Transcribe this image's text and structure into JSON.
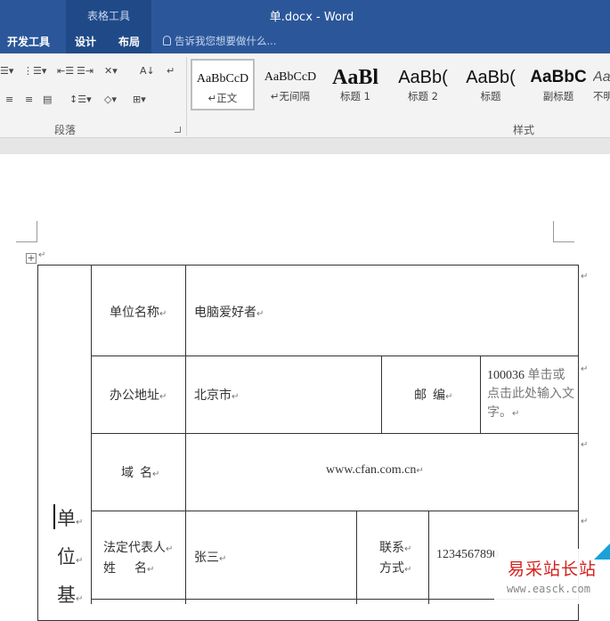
{
  "app": {
    "context_tab": "表格工具",
    "title": "单.docx - Word"
  },
  "tabs": [
    "开发工具",
    "设计",
    "布局"
  ],
  "tell_me": "告诉我您想要做什么...",
  "groups": {
    "paragraph": "段落",
    "styles": "样式"
  },
  "styles": [
    {
      "preview": "AaBbCcD",
      "name": "↵正文"
    },
    {
      "preview": "AaBbCcD",
      "name": "↵无间隔"
    },
    {
      "preview": "AaBl",
      "name": "标题 1"
    },
    {
      "preview": "AaBb(",
      "name": "标题 2"
    },
    {
      "preview": "AaBb(",
      "name": "标题"
    },
    {
      "preview": "AaBbC",
      "name": "副标题"
    },
    {
      "preview": "Aa",
      "name": "不明"
    }
  ],
  "table": {
    "side_label": [
      "单",
      "位",
      "基"
    ],
    "unit_name_label": "单位名称",
    "unit_name_value": "电脑爱好者",
    "address_label": "办公地址",
    "address_value": "北京市",
    "postcode_label": "邮  编",
    "postcode_value": "100036",
    "postcode_hint": "单击或点击此处输入文字。",
    "domain_label": "域  名",
    "domain_value": "www.cfan.com.cn",
    "legal_rep_label_1": "法定代表人",
    "legal_rep_label_2": "姓      名",
    "legal_rep_value": "张三",
    "contact_label_1": "联系",
    "contact_label_2": "方式",
    "contact_value": "1234567890"
  },
  "watermark": {
    "text": "易采站长站",
    "url": "www.easck.com"
  }
}
